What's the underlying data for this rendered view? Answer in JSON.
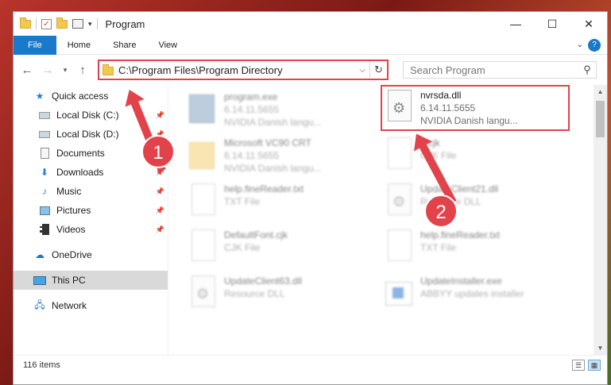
{
  "window": {
    "title": "Program",
    "controls": {
      "minimize": "—",
      "maximize": "☐",
      "close": "✕"
    }
  },
  "ribbon": {
    "tabs": [
      "File",
      "Home",
      "Share",
      "View"
    ],
    "help": "?"
  },
  "address": {
    "path": "C:\\Program Files\\Program Directory"
  },
  "search": {
    "placeholder": "Search Program"
  },
  "nav": {
    "quick_access": "Quick access",
    "items": [
      {
        "label": "Local Disk (C:)",
        "pinned": true
      },
      {
        "label": "Local Disk (D:)",
        "pinned": true
      },
      {
        "label": "Documents",
        "pinned": true
      },
      {
        "label": "Downloads",
        "pinned": true
      },
      {
        "label": "Music",
        "pinned": true
      },
      {
        "label": "Pictures",
        "pinned": true
      },
      {
        "label": "Videos",
        "pinned": true
      }
    ],
    "onedrive": "OneDrive",
    "this_pc": "This PC",
    "network": "Network"
  },
  "files": {
    "left": [
      {
        "name": "program.exe",
        "line2": "6.14.11.5655",
        "line3": "NVIDIA Danish langu..."
      },
      {
        "name": "Microsoft VC90 CRT",
        "line2": "6.14.11.5655",
        "line3": "NVIDIA Danish langu..."
      },
      {
        "name": "help.fineReader.txt",
        "line2": "TXT File",
        "line3": ""
      },
      {
        "name": "DefaultFont.cjk",
        "line2": "CJK File",
        "line3": ""
      },
      {
        "name": "UpdateClient63.dll",
        "line2": "Resource DLL",
        "line3": ""
      }
    ],
    "right": [
      {
        "name": "nvrsda.dll",
        "line2": "6.14.11.5655",
        "line3": "NVIDIA Danish langu..."
      },
      {
        "name": "...cjk",
        "line2": "CJK File",
        "line3": ""
      },
      {
        "name": "UpdateClient21.dll",
        "line2": "Resource DLL",
        "line3": ""
      },
      {
        "name": "help.fineReader.txt",
        "line2": "TXT File",
        "line3": ""
      },
      {
        "name": "UpdateInstaller.exe",
        "line2": "ABBYY updates installer",
        "line3": ""
      }
    ]
  },
  "status": {
    "items": "116 items"
  },
  "annotations": {
    "one": "1",
    "two": "2"
  },
  "colors": {
    "accent": "#1979ca",
    "highlight": "#e2434b"
  }
}
